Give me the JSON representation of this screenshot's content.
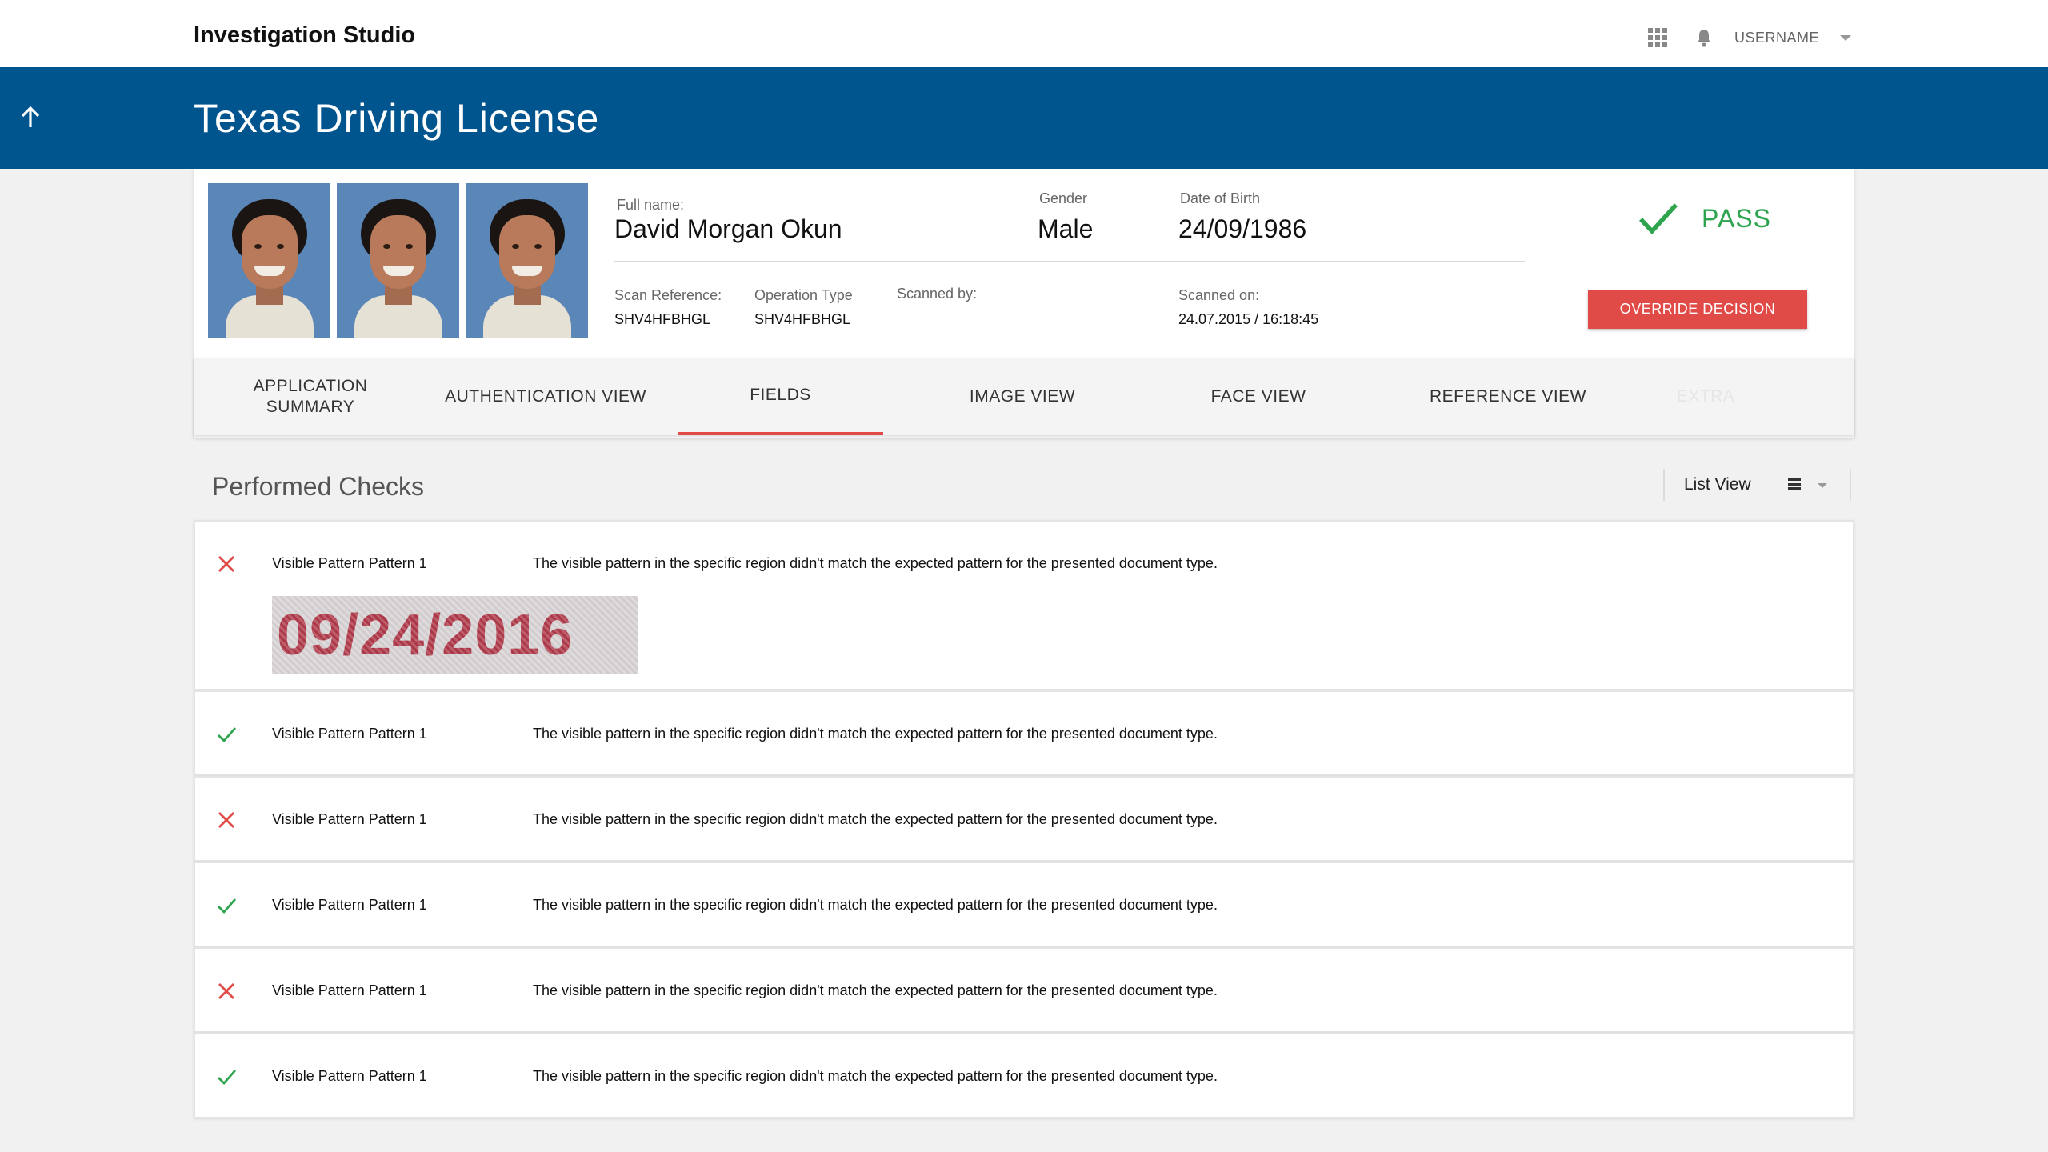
{
  "app": {
    "title": "Investigation Studio"
  },
  "topbar": {
    "username": "USERNAME",
    "icons": [
      "apps-grid-icon",
      "bell-icon",
      "chevron-down-icon"
    ]
  },
  "header": {
    "title": "Texas Driving License",
    "back_icon": "arrow-up-icon"
  },
  "document": {
    "full_name_label": "Full name:",
    "full_name": "David Morgan Okun",
    "gender_label": "Gender",
    "gender": "Male",
    "dob_label": "Date of Birth",
    "dob": "24/09/1986",
    "scan_ref_label": "Scan Reference:",
    "scan_ref": "SHV4HFBHGL",
    "op_type_label": "Operation Type",
    "op_type": "SHV4HFBHGL",
    "scanned_by_label": "Scanned by:",
    "scanned_on_label": "Scanned on:",
    "scanned_on": "24.07.2015 / 16:18:45",
    "decision": "PASS",
    "override_label": "OVERRIDE DECISION",
    "colors": {
      "pass": "#2ea44f",
      "fail": "#e04b47",
      "brand": "#00558f"
    }
  },
  "tabs": [
    {
      "label": "APPLICATION SUMMARY",
      "active": false
    },
    {
      "label": "AUTHENTICATION VIEW",
      "active": false
    },
    {
      "label": "FIELDS",
      "active": true
    },
    {
      "label": "IMAGE VIEW",
      "active": false
    },
    {
      "label": "FACE VIEW",
      "active": false
    },
    {
      "label": "REFERENCE VIEW",
      "active": false
    },
    {
      "label": "EXTRA",
      "active": false
    }
  ],
  "checks": {
    "title": "Performed Checks",
    "view_label": "List View",
    "rows": [
      {
        "status": "fail",
        "name": "Visible Pattern Pattern 1",
        "description": "The visible pattern in the specific region didn't match the expected pattern for the presented document type.",
        "evidence_text": "09/24/2016"
      },
      {
        "status": "pass",
        "name": "Visible Pattern Pattern 1",
        "description": "The visible pattern in the specific region didn't match the expected pattern for the presented document type."
      },
      {
        "status": "fail",
        "name": "Visible Pattern Pattern 1",
        "description": "The visible pattern in the specific region didn't match the expected pattern for the presented document type."
      },
      {
        "status": "pass",
        "name": "Visible Pattern Pattern 1",
        "description": "The visible pattern in the specific region didn't match the expected pattern for the presented document type."
      },
      {
        "status": "fail",
        "name": "Visible Pattern Pattern 1",
        "description": "The visible pattern in the specific region didn't match the expected pattern for the presented document type."
      },
      {
        "status": "pass",
        "name": "Visible Pattern Pattern 1",
        "description": "The visible pattern in the specific region didn't match the expected pattern for the presented document type."
      }
    ]
  }
}
